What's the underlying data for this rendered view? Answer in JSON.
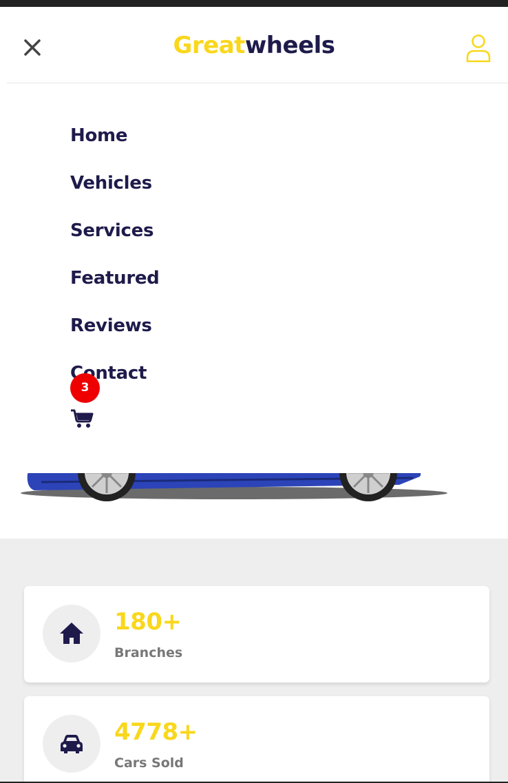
{
  "brand": {
    "part1": "Great",
    "part2": "wheels"
  },
  "colors": {
    "accent": "#f9d71c",
    "navy": "#1e1b4b",
    "badge": "#ee0000",
    "muted": "#777777"
  },
  "header": {
    "close_icon": "close-icon",
    "user_icon": "user-icon"
  },
  "menu": {
    "items": [
      {
        "label": "Home"
      },
      {
        "label": "Vehicles"
      },
      {
        "label": "Services"
      },
      {
        "label": "Featured"
      },
      {
        "label": "Reviews"
      },
      {
        "label": "Contact"
      }
    ],
    "cart": {
      "icon": "cart-icon",
      "count": "3"
    }
  },
  "stats": [
    {
      "icon": "home-icon",
      "value": "180+",
      "label": "Branches"
    },
    {
      "icon": "car-icon",
      "value": "4778+",
      "label": "Cars Sold"
    }
  ]
}
